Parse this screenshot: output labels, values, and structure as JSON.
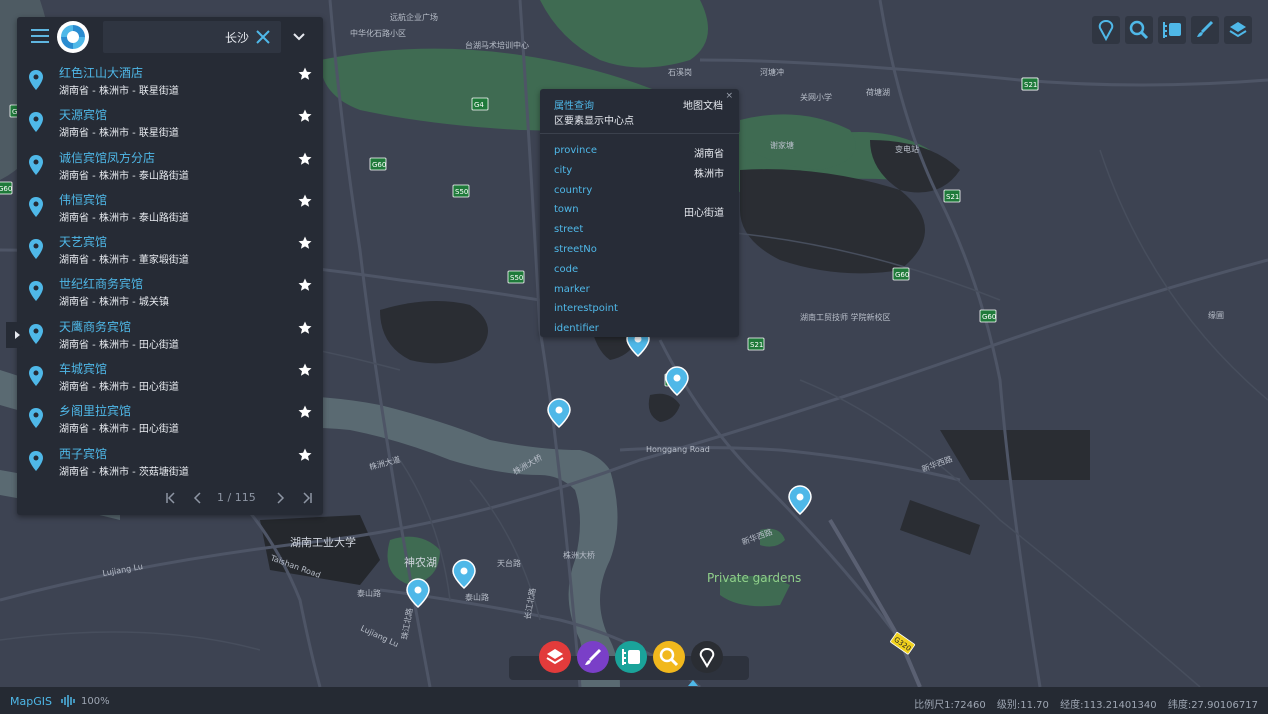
{
  "search": {
    "query": "长沙",
    "results": [
      {
        "name": "红色江山大酒店",
        "address": "湖南省 - 株洲市 - 联星街道"
      },
      {
        "name": "天源宾馆",
        "address": "湖南省 - 株洲市 - 联星街道"
      },
      {
        "name": "诚信宾馆凤方分店",
        "address": "湖南省 - 株洲市 - 泰山路街道"
      },
      {
        "name": "伟恒宾馆",
        "address": "湖南省 - 株洲市 - 泰山路街道"
      },
      {
        "name": "天艺宾馆",
        "address": "湖南省 - 株洲市 - 董家塅街道"
      },
      {
        "name": "世纪红商务宾馆",
        "address": "湖南省 - 株洲市 - 城关镇"
      },
      {
        "name": "天鹰商务宾馆",
        "address": "湖南省 - 株洲市 - 田心街道"
      },
      {
        "name": "车城宾馆",
        "address": "湖南省 - 株洲市 - 田心街道"
      },
      {
        "name": "乡阁里拉宾馆",
        "address": "湖南省 - 株洲市 - 田心街道"
      },
      {
        "name": "西子宾馆",
        "address": "湖南省 - 株洲市 - 茨菇塘街道"
      }
    ],
    "page": "1 / 115"
  },
  "popup": {
    "title": "属性查询",
    "doc": "地图文档",
    "subtitle": "区要素显示中心点",
    "close": "×",
    "rows": [
      {
        "key": "province",
        "value": "湖南省"
      },
      {
        "key": "city",
        "value": "株洲市"
      },
      {
        "key": "country",
        "value": ""
      },
      {
        "key": "town",
        "value": "田心街道"
      },
      {
        "key": "street",
        "value": ""
      },
      {
        "key": "streetNo",
        "value": ""
      },
      {
        "key": "code",
        "value": ""
      },
      {
        "key": "marker",
        "value": ""
      },
      {
        "key": "interestpoint",
        "value": ""
      },
      {
        "key": "identifier",
        "value": ""
      }
    ]
  },
  "map_labels": {
    "university": "湖南工业大学",
    "lake": "神农湖",
    "gardens": "Private gardens",
    "road_honggang": "Honggang Road",
    "road_taishan": "Taishan Road",
    "road_lujiang": "Lujiang Lu",
    "road_lujiang2": "Lujiang Lu",
    "college": "湖南工贸技师\n学院新校区",
    "market": "远航企业广场",
    "zhonghua": "中华化石路小区",
    "racecourse": "台湖马术培训中心",
    "shixiagang": "石溪岗",
    "hedong": "河塘冲",
    "guanwang": "关网小学",
    "bianzhan": "变电站",
    "shuanghu": "荷塘湖",
    "xietang": "谢家塘",
    "zhucheng": "株洲大桥",
    "zhuzhou": "株洲大桥",
    "yuanpu": "缘圃",
    "xinhua": "新华西路",
    "xinhua2": "新华西路",
    "taishanlu": "泰山路",
    "taishanlu2": "泰山路",
    "tiantai": "天台路",
    "changjiang": "长江北路",
    "zhujiang": "珠江北路",
    "zhuzhou_dadao": "株洲大道"
  },
  "shields": [
    "G60",
    "G4",
    "G60",
    "S50",
    "S50",
    "S21",
    "S21",
    "G60",
    "G60",
    "S21",
    "G320",
    "S21",
    "G60",
    "S21"
  ],
  "status": {
    "brand": "MapGIS",
    "network": "100%",
    "scale": "比例尺1:72460",
    "level": "级别:11.70",
    "lon": "经度:113.21401340",
    "lat": "纬度:27.90106717"
  },
  "colors": {
    "accent": "#4fb8e8",
    "land": "#3d4352",
    "water": "#5a6a72",
    "park": "#3f6b52",
    "dark_block": "#2a2d33",
    "btn_layers": "#e23b3b",
    "btn_draw": "#7a3fc8",
    "btn_frame": "#1aa39a",
    "btn_query": "#f1b81d",
    "btn_marker": "#2a2d33"
  },
  "icons": [
    "menu-icon",
    "logo-icon",
    "clear-icon",
    "chevron-down-icon",
    "location-pin-icon",
    "star-icon",
    "first-page-icon",
    "prev-page-icon",
    "next-page-icon",
    "last-page-icon",
    "expand-arrow-icon",
    "marker-tool-icon",
    "search-zoom-icon",
    "frame-icon",
    "draw-icon",
    "layers-icon",
    "network-icon"
  ]
}
